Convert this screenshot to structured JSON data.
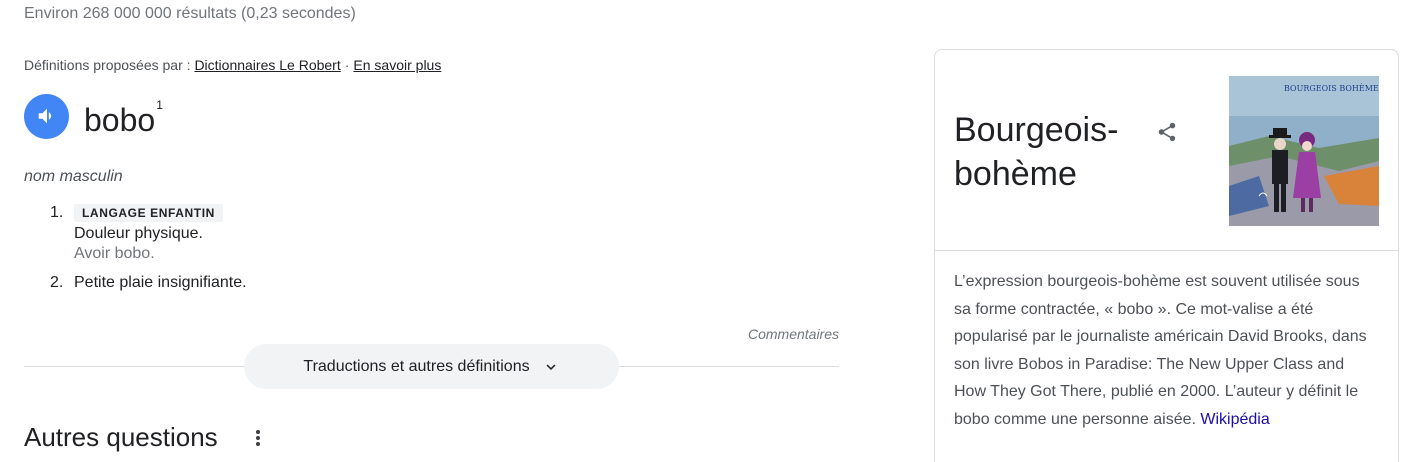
{
  "stats": "Environ 268 000 000 résultats (0,23 secondes)",
  "source": {
    "prefix": "Définitions proposées par :",
    "provider": "Dictionnaires Le Robert",
    "separator": "·",
    "learn_more": "En savoir plus"
  },
  "entry": {
    "speaker_icon": "speaker-icon",
    "word": "bobo",
    "homograph": "1",
    "part_of_speech": "nom masculin",
    "senses": [
      {
        "number": "1.",
        "tag": "LANGAGE ENFANTIN",
        "definition": "Douleur physique.",
        "example": "Avoir bobo."
      },
      {
        "number": "2.",
        "definition": "Petite plaie insignifiante."
      }
    ]
  },
  "feedback": "Commentaires",
  "more_button": {
    "label": "Traductions et autres définitions",
    "icon": "chevron-down-icon"
  },
  "related": {
    "title": "Autres questions",
    "icon": "more-vert-icon"
  },
  "knowledge_panel": {
    "title_line1": "Bourgeois-",
    "title_line2": "bohème",
    "share_icon": "share-icon",
    "image_caption": "BOURGEOIS BOHÈME",
    "description": "L’expression bourgeois-bohème est souvent utilisée sous sa forme contractée, « bobo ». Ce mot-valise a été popularisé par le journaliste américain David Brooks, dans son livre Bobos in Paradise: The New Upper Class and How They Got There, publié en 2000. L’auteur y définit le bobo comme une personne aisée.",
    "source_link": "Wikipédia"
  },
  "colors": {
    "accent": "#4285f4",
    "link": "#1a0dab",
    "muted": "#70757a",
    "chip": "#f1f3f4"
  }
}
